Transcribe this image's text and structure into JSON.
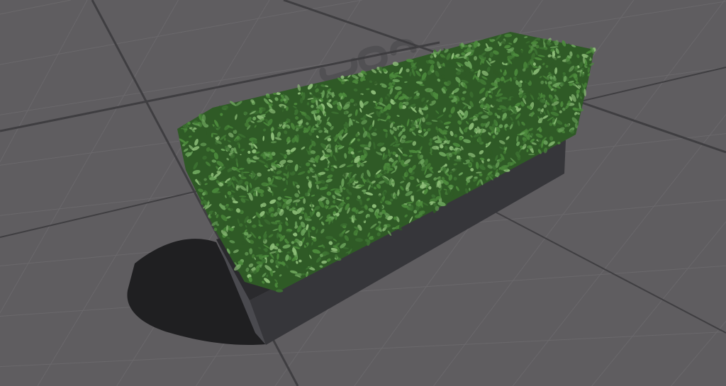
{
  "scene": {
    "subject": "hedge-in-planter",
    "colors": {
      "floor": "#5f5d60",
      "grid_major": "#3f3e41",
      "grid_minor": "#6a686b",
      "planter_front": "#36363a",
      "planter_side": "#4a4a4f",
      "planter_top": "#2a2a2d",
      "shadow": "#1f1f21",
      "leaf_dark": "#2f5a26",
      "leaf_mid": "#4c8a3c",
      "leaf_light": "#8fbf7a"
    }
  }
}
